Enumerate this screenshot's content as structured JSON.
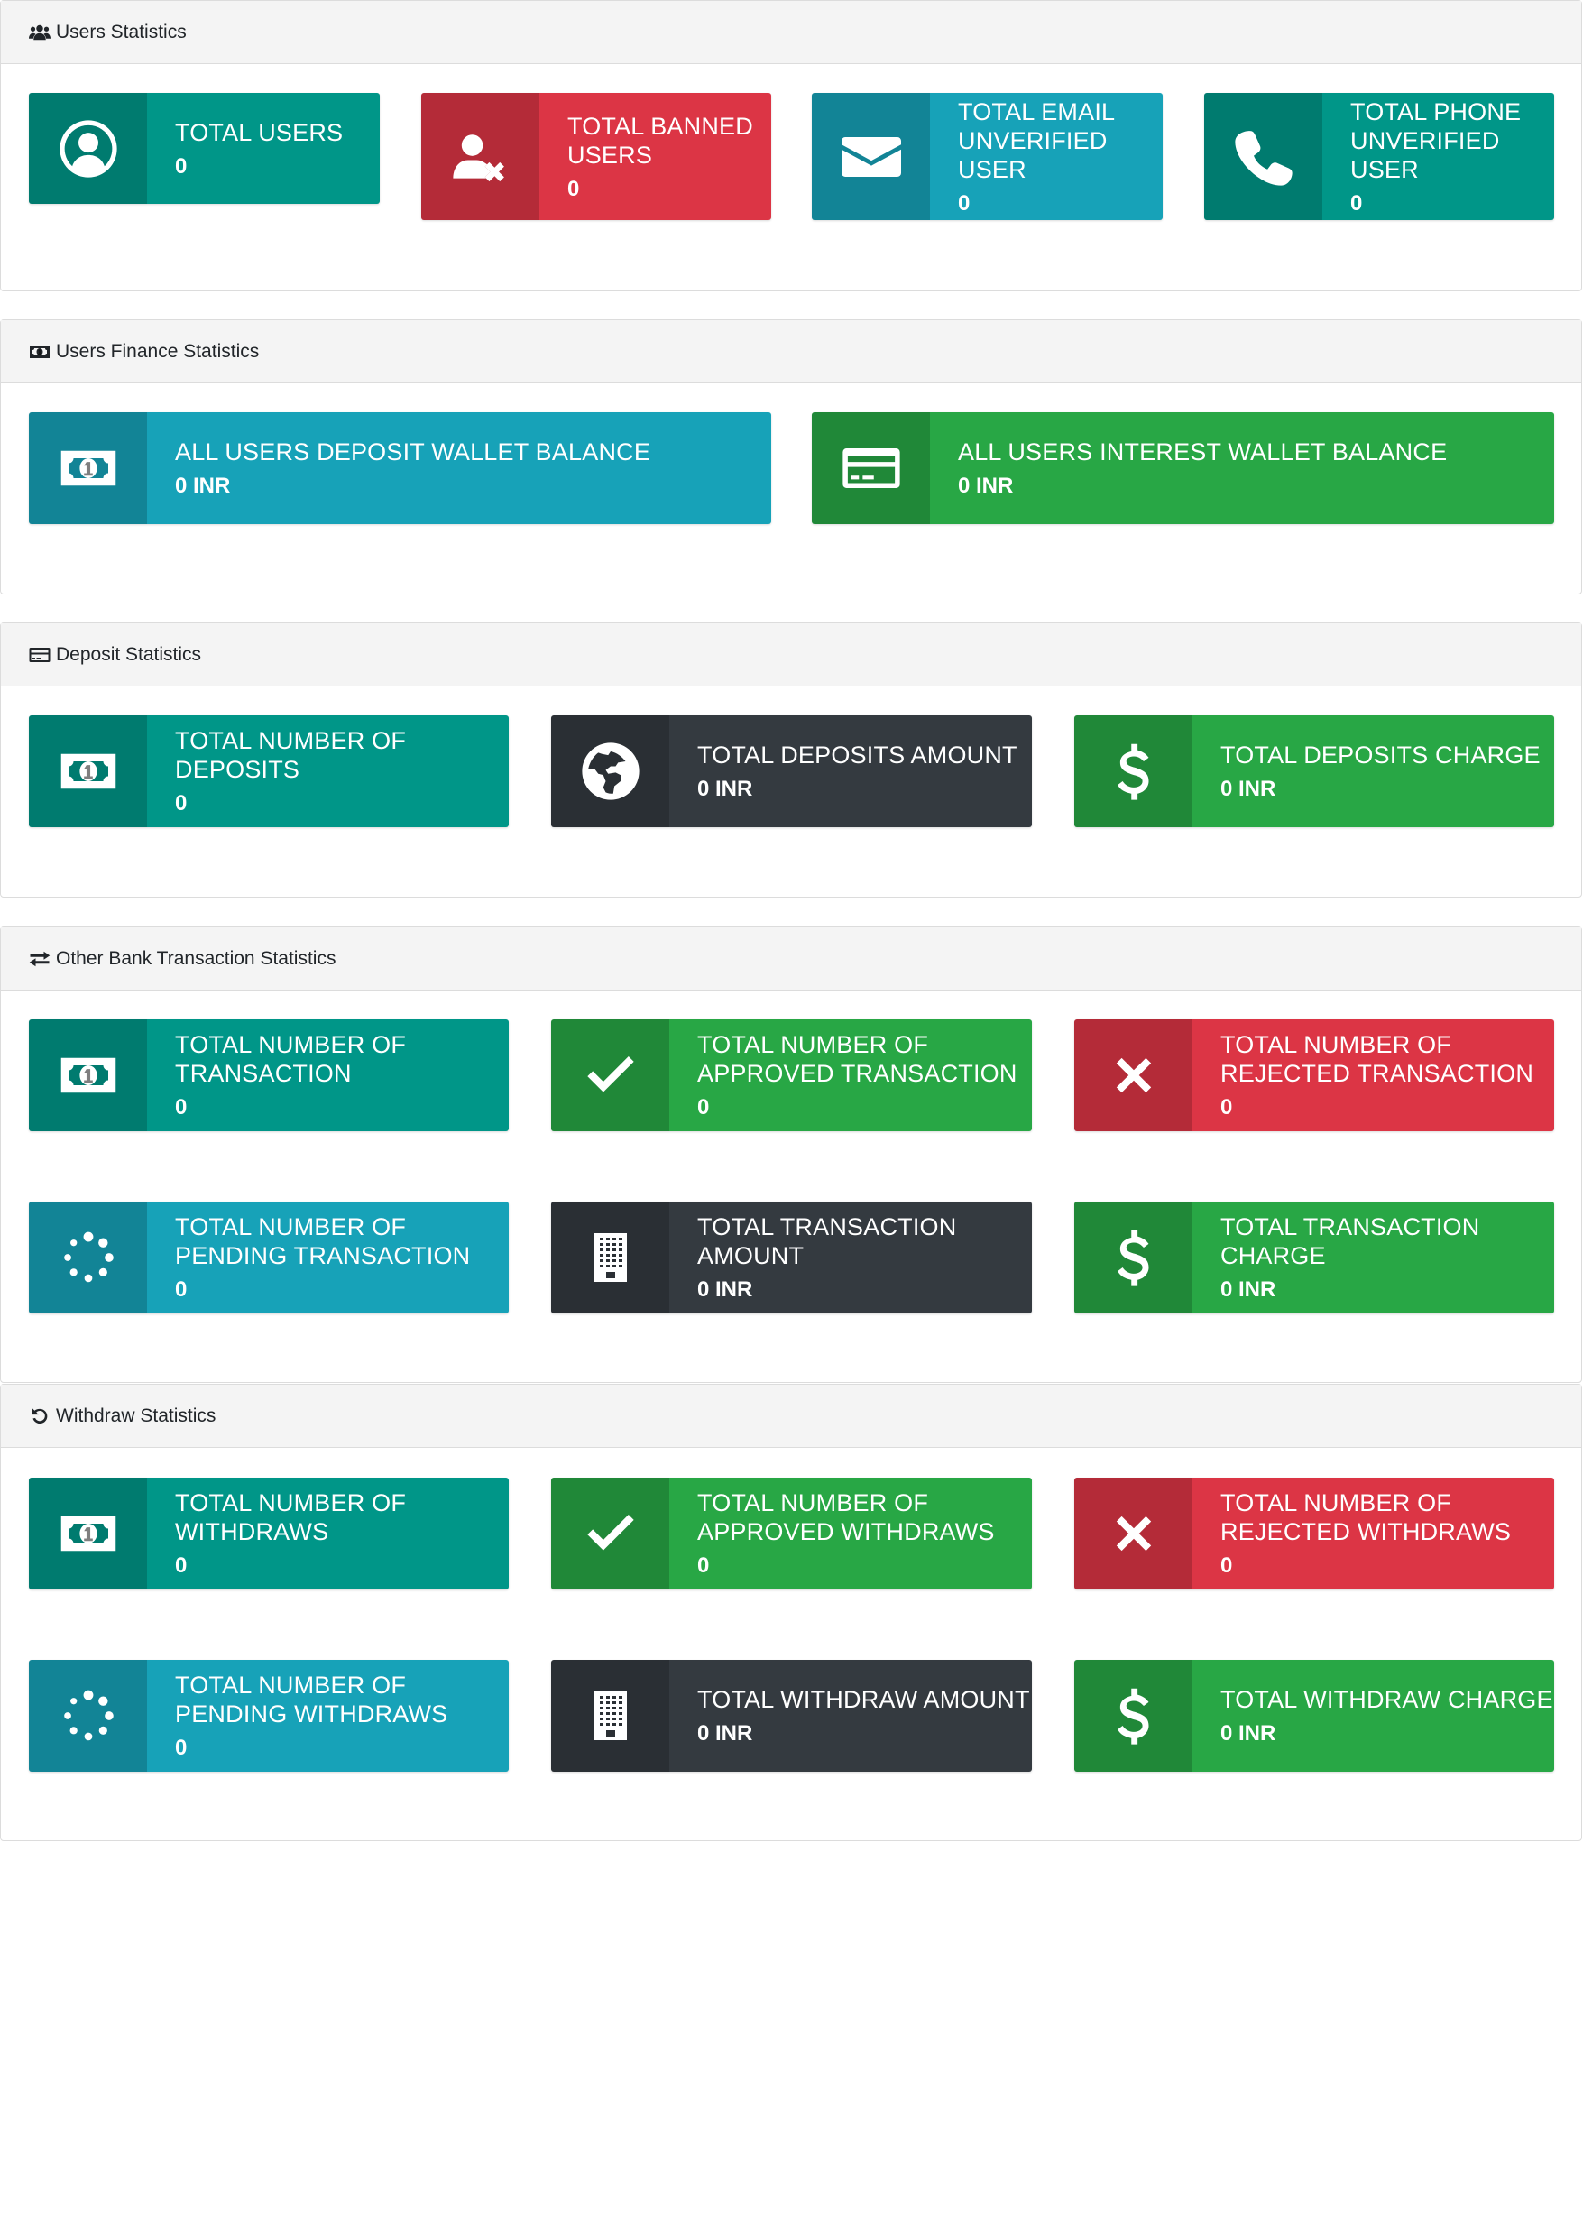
{
  "sections": [
    {
      "title": "Users Statistics",
      "icon": "users-icon",
      "boxes": [
        {
          "label": "TOTAL USERS",
          "value": "0",
          "icon": "user-circle-icon",
          "color": "#009688"
        },
        {
          "label": "TOTAL BANNED USERS",
          "value": "0",
          "icon": "user-times-icon",
          "color": "#dc3545"
        },
        {
          "label": "TOTAL EMAIL UNVERIFIED USER",
          "value": "0",
          "icon": "envelope-icon",
          "color": "#17a2b8"
        },
        {
          "label": "TOTAL PHONE UNVERIFIED USER",
          "value": "0",
          "icon": "phone-icon",
          "color": "#009688"
        }
      ]
    },
    {
      "title": "Users Finance Statistics",
      "icon": "money-bill-icon",
      "boxes": [
        {
          "label": "ALL USERS DEPOSIT WALLET BALANCE",
          "value": "0 INR",
          "icon": "money-bill-icon",
          "color": "#17a2b8"
        },
        {
          "label": "ALL USERS INTEREST WALLET BALANCE",
          "value": "0 INR",
          "icon": "credit-card-icon",
          "color": "#28a745"
        }
      ]
    },
    {
      "title": "Deposit Statistics",
      "icon": "credit-card-icon",
      "boxes": [
        {
          "label": "TOTAL NUMBER OF DEPOSITS",
          "value": "0",
          "icon": "money-bill-icon",
          "color": "#009688"
        },
        {
          "label": "TOTAL DEPOSITS AMOUNT",
          "value": "0 INR",
          "icon": "globe-icon",
          "color": "#343a40"
        },
        {
          "label": "TOTAL DEPOSITS CHARGE",
          "value": "0 INR",
          "icon": "dollar-icon",
          "color": "#28a745"
        }
      ]
    },
    {
      "title": "Other Bank Transaction Statistics",
      "icon": "exchange-icon",
      "boxes": [
        {
          "label": "TOTAL NUMBER OF TRANSACTION",
          "value": "0",
          "icon": "money-bill-icon",
          "color": "#009688"
        },
        {
          "label": "TOTAL NUMBER OF APPROVED TRANSACTION",
          "value": "0",
          "icon": "check-icon",
          "color": "#28a745"
        },
        {
          "label": "TOTAL NUMBER OF REJECTED TRANSACTION",
          "value": "0",
          "icon": "times-icon",
          "color": "#dc3545"
        },
        {
          "label": "TOTAL NUMBER OF PENDING TRANSACTION",
          "value": "0",
          "icon": "spinner-icon",
          "color": "#17a2b8"
        },
        {
          "label": "TOTAL TRANSACTION AMOUNT",
          "value": "0 INR",
          "icon": "building-icon",
          "color": "#343a40"
        },
        {
          "label": "TOTAL TRANSACTION CHARGE",
          "value": "0 INR",
          "icon": "dollar-icon",
          "color": "#28a745"
        }
      ]
    },
    {
      "title": "Withdraw Statistics",
      "icon": "undo-icon",
      "boxes": [
        {
          "label": "TOTAL NUMBER OF WITHDRAWS",
          "value": "0",
          "icon": "money-bill-icon",
          "color": "#009688"
        },
        {
          "label": "TOTAL NUMBER OF APPROVED WITHDRAWS",
          "value": "0",
          "icon": "check-icon",
          "color": "#28a745"
        },
        {
          "label": "TOTAL NUMBER OF REJECTED WITHDRAWS",
          "value": "0",
          "icon": "times-icon",
          "color": "#dc3545"
        },
        {
          "label": "TOTAL NUMBER OF PENDING WITHDRAWS",
          "value": "0",
          "icon": "spinner-icon",
          "color": "#17a2b8"
        },
        {
          "label": "TOTAL WITHDRAW AMOUNT",
          "value": "0 INR",
          "icon": "building-icon",
          "color": "#343a40"
        },
        {
          "label": "TOTAL WITHDRAW CHARGE",
          "value": "0 INR",
          "icon": "dollar-icon",
          "color": "#28a745"
        }
      ]
    }
  ]
}
